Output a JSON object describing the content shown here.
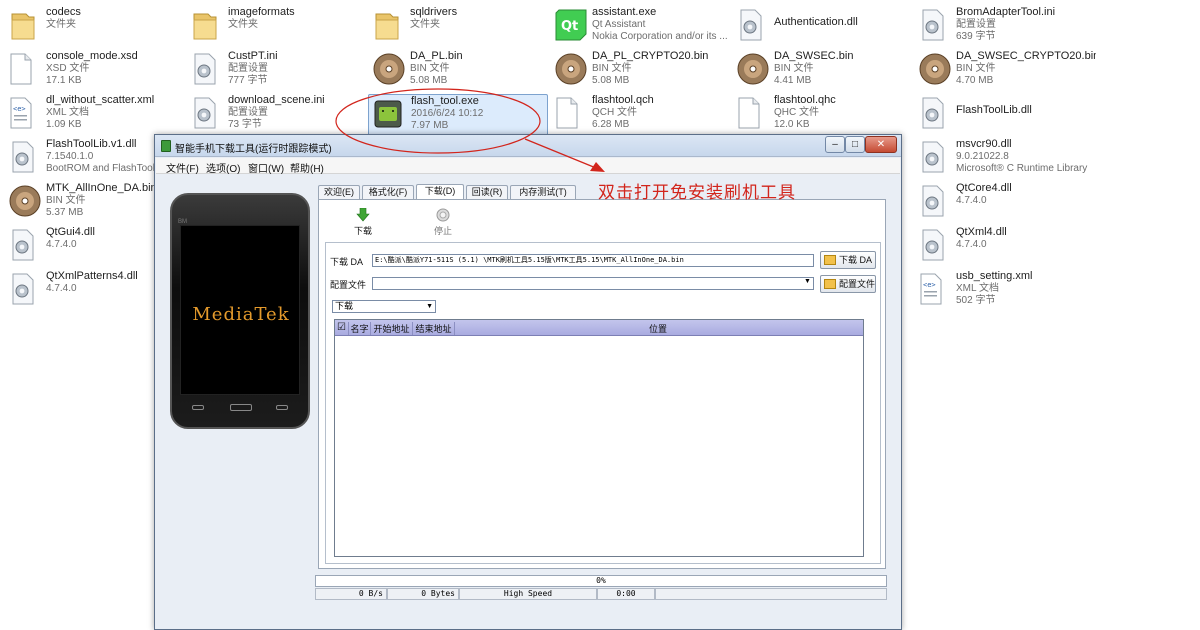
{
  "files": [
    {
      "name": "codecs",
      "sub1": "文件夹",
      "sub2": "",
      "icon": "folder-icon"
    },
    {
      "name": "imageformats",
      "sub1": "文件夹",
      "sub2": "",
      "icon": "folder-icon"
    },
    {
      "name": "sqldrivers",
      "sub1": "文件夹",
      "sub2": "",
      "icon": "folder-icon"
    },
    {
      "name": "assistant.exe",
      "sub1": "Qt Assistant",
      "sub2": "Nokia Corporation and/or its ...",
      "icon": "qt-icon"
    },
    {
      "name": "Authentication.dll",
      "sub1": "",
      "sub2": "",
      "icon": "gear-file-icon"
    },
    {
      "name": "BromAdapterTool.ini",
      "sub1": "配置设置",
      "sub2": "639 字节",
      "icon": "gear-file-icon"
    },
    {
      "name": "console_mode.xsd",
      "sub1": "XSD 文件",
      "sub2": "17.1 KB",
      "icon": "blank-file-icon"
    },
    {
      "name": "CustPT.ini",
      "sub1": "配置设置",
      "sub2": "777 字节",
      "icon": "gear-file-icon"
    },
    {
      "name": "DA_PL.bin",
      "sub1": "BIN 文件",
      "sub2": "5.08 MB",
      "icon": "disc-icon"
    },
    {
      "name": "DA_PL_CRYPTO20.bin",
      "sub1": "BIN 文件",
      "sub2": "5.08 MB",
      "icon": "disc-icon"
    },
    {
      "name": "DA_SWSEC.bin",
      "sub1": "BIN 文件",
      "sub2": "4.41 MB",
      "icon": "disc-icon"
    },
    {
      "name": "DA_SWSEC_CRYPTO20.bin",
      "sub1": "BIN 文件",
      "sub2": "4.70 MB",
      "icon": "disc-icon"
    },
    {
      "name": "dl_without_scatter.xml",
      "sub1": "XML 文档",
      "sub2": "1.09 KB",
      "icon": "xml-file-icon"
    },
    {
      "name": "download_scene.ini",
      "sub1": "配置设置",
      "sub2": "73 字节",
      "icon": "gear-file-icon"
    },
    {
      "name": "flash_tool.exe",
      "sub1": "2016/6/24 10:12",
      "sub2": "7.97 MB",
      "icon": "android-icon"
    },
    {
      "name": "flashtool.qch",
      "sub1": "QCH 文件",
      "sub2": "6.28 MB",
      "icon": "blank-file-icon"
    },
    {
      "name": "flashtool.qhc",
      "sub1": "QHC 文件",
      "sub2": "12.0 KB",
      "icon": "blank-file-icon"
    },
    {
      "name": "FlashToolLib.dll",
      "sub1": "",
      "sub2": "",
      "icon": "gear-file-icon"
    },
    {
      "name": "FlashToolLib.v1.dll",
      "sub1": "7.1540.1.0",
      "sub2": "BootROM and FlashTool C",
      "icon": "gear-file-icon"
    },
    {
      "name": "msvcr90.dll",
      "sub1": "9.0.21022.8",
      "sub2": "Microsoft® C Runtime Library",
      "icon": "gear-file-icon"
    },
    {
      "name": "MTK_AllInOne_DA.bin",
      "sub1": "BIN 文件",
      "sub2": "5.37 MB",
      "icon": "disc-icon"
    },
    {
      "name": "QtCore4.dll",
      "sub1": "4.7.4.0",
      "sub2": "",
      "icon": "gear-file-icon"
    },
    {
      "name": "QtGui4.dll",
      "sub1": "4.7.4.0",
      "sub2": "",
      "icon": "gear-file-icon"
    },
    {
      "name": "QtXml4.dll",
      "sub1": "4.7.4.0",
      "sub2": "",
      "icon": "gear-file-icon"
    },
    {
      "name": "QtXmlPatterns4.dll",
      "sub1": "4.7.4.0",
      "sub2": "",
      "icon": "gear-file-icon"
    },
    {
      "name": "usb_setting.xml",
      "sub1": "XML 文档",
      "sub2": "502 字节",
      "icon": "xml-file-icon"
    }
  ],
  "window": {
    "title": "智能手机下载工具(运行时跟踪模式)",
    "menu": [
      "文件(F)",
      "选项(O)",
      "窗口(W)",
      "帮助(H)"
    ],
    "tabs": [
      "欢迎(E)",
      "格式化(F)",
      "下载(D)",
      "回读(R)",
      "内存测试(T)"
    ],
    "active_tab": 2,
    "phone_screen_text": "MediaTek",
    "phone_brand": "BM",
    "toolbar": {
      "download": "下载",
      "stop": "停止"
    },
    "da_label": "下载 DA",
    "da_path": "E:\\酷派\\酷派Y71-511S (5.1) \\MTK刷机工具5.15版\\MTK工具5.15\\MTK_AllInOne_DA.bin",
    "da_button": "下载 DA",
    "scatter_label": "配置文件",
    "scatter_value": "",
    "scatter_button": "配置文件",
    "mode_value": "下载",
    "table_headers": [
      "",
      "名字",
      "开始地址",
      "结束地址",
      "位置"
    ],
    "table_check": "☑",
    "progress": "0%",
    "status_cells": [
      "0 B/s",
      "0 Bytes",
      "High Speed",
      "0:00"
    ]
  },
  "annotation": "双击打开免安装刷机工具",
  "colors": {
    "annotation_red": "#d2251c",
    "header_purple": "#b4b6e6"
  }
}
